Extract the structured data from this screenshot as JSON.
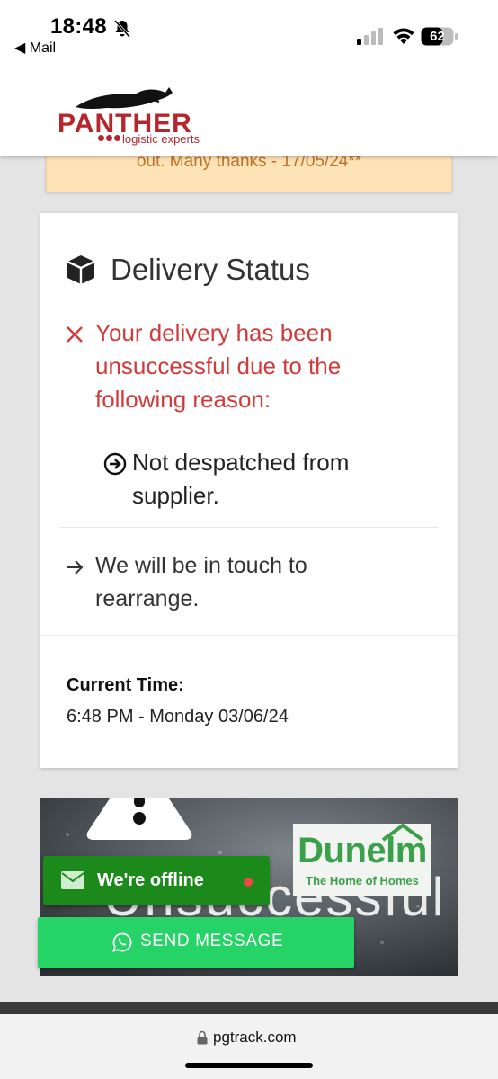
{
  "status_bar": {
    "time": "18:48",
    "back_label": "◀ Mail",
    "battery": "62"
  },
  "brand": {
    "name": "PANTHER",
    "tagline": "logistic experts"
  },
  "notice": {
    "text": "out. Many thanks - 17/05/24**"
  },
  "delivery": {
    "title": "Delivery Status",
    "error_message": "Your delivery has been unsuccessful due to the following reason:",
    "reason": "Not despatched from supplier.",
    "follow_up": "We will be in touch to rearrange.",
    "current_time_label": "Current Time:",
    "current_time_value": "6:48 PM - Monday 03/06/24"
  },
  "banner": {
    "headline": "Unsuccessful",
    "partner_name": "Dunelm",
    "partner_tagline": "The Home of Homes"
  },
  "chat": {
    "status": "We're offline",
    "send_label": "SEND MESSAGE"
  },
  "browser": {
    "url": "pgtrack.com"
  },
  "colors": {
    "error": "#d13b3b",
    "notice_bg": "#fde3b6",
    "offline_bg": "#1b8a1b",
    "send_bg": "#25d366",
    "brand_red": "#b5252b"
  }
}
